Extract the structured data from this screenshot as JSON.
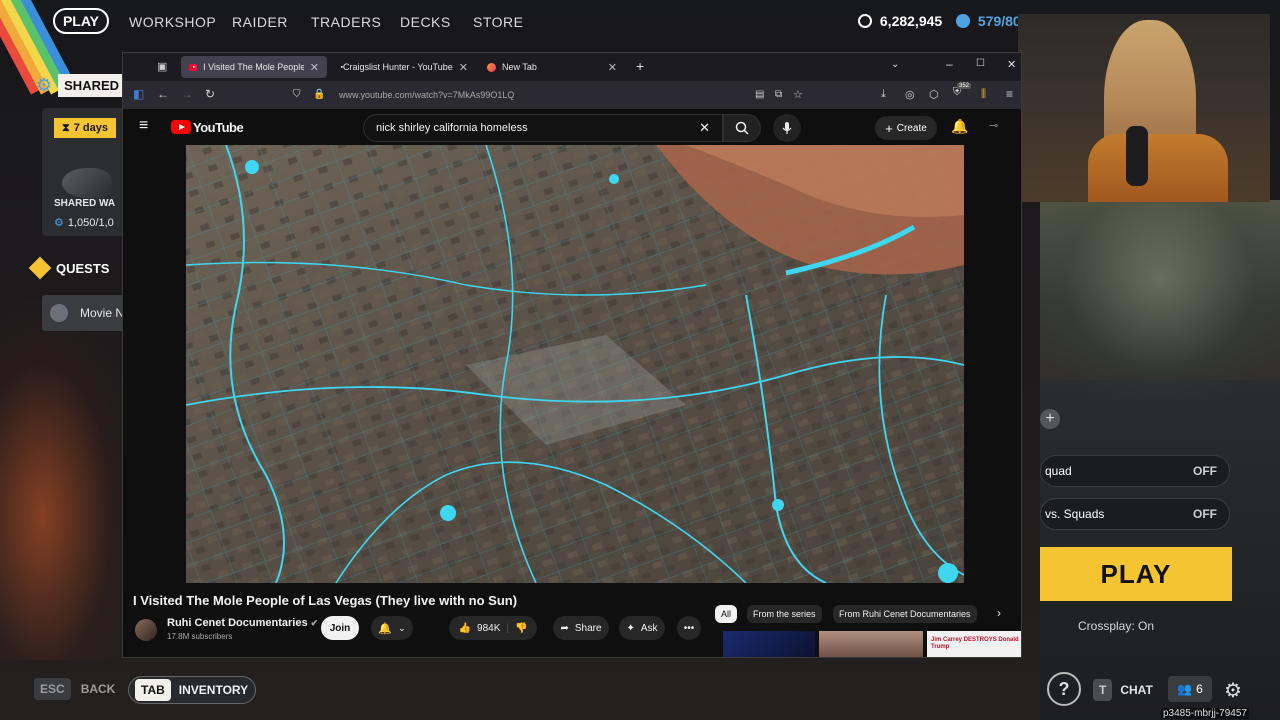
{
  "game_nav": {
    "play": "PLAY",
    "items": [
      "WORKSHOP",
      "RAIDER",
      "TRADERS",
      "DECKS",
      "STORE"
    ],
    "coins": "6,282,945",
    "tokens": "579/80"
  },
  "left_panel": {
    "shared_header": "SHARED W",
    "timer_label": "7 days",
    "shared_item_label": "SHARED WA",
    "shared_item_progress": "1,050/1,0",
    "quests_header": "QUESTS",
    "quest_item": "Movie N"
  },
  "right_panel": {
    "squad_toggle_label": "quad",
    "squad_toggle_value": "OFF",
    "vs_toggle_label": "vs. Squads",
    "vs_toggle_value": "OFF",
    "play_button": "PLAY",
    "crossplay": "Crossplay: On"
  },
  "bottom_bar": {
    "esc_key": "ESC",
    "back_label": "BACK",
    "tab_key": "TAB",
    "inventory_label": "INVENTORY",
    "help_key": "?",
    "chat_key": "T",
    "chat_label": "CHAT",
    "friends_count": "6",
    "session_id": "p3485-mbrjj-79457"
  },
  "browser": {
    "tabs": [
      {
        "label": "I Visited The Mole People of La"
      },
      {
        "label": "Craigslist Hunter - YouTube"
      },
      {
        "label": "New Tab"
      }
    ],
    "url": "www.youtube.com/watch?v=7MkAs99O1LQ",
    "badge": "352"
  },
  "youtube": {
    "logo_text": "YouTube",
    "search_value": "nick shirley california homeless",
    "create_label": "Create",
    "video_title": "I Visited The Mole People of Las Vegas (They live with no Sun)",
    "channel_name": "Ruhi Cenet Documentaries",
    "subscribers": "17.8M subscribers",
    "join_label": "Join",
    "likes": "984K",
    "share_label": "Share",
    "ask_label": "Ask",
    "chips": [
      "All",
      "From the series",
      "From Ruhi Cenet Documentaries"
    ],
    "thumb_caption": "Jim Carrey DESTROYS Donald Trump"
  },
  "colors": {
    "accent_yellow": "#f4c431",
    "youtube_red": "#ff0000",
    "map_river": "#3fd6f2"
  }
}
